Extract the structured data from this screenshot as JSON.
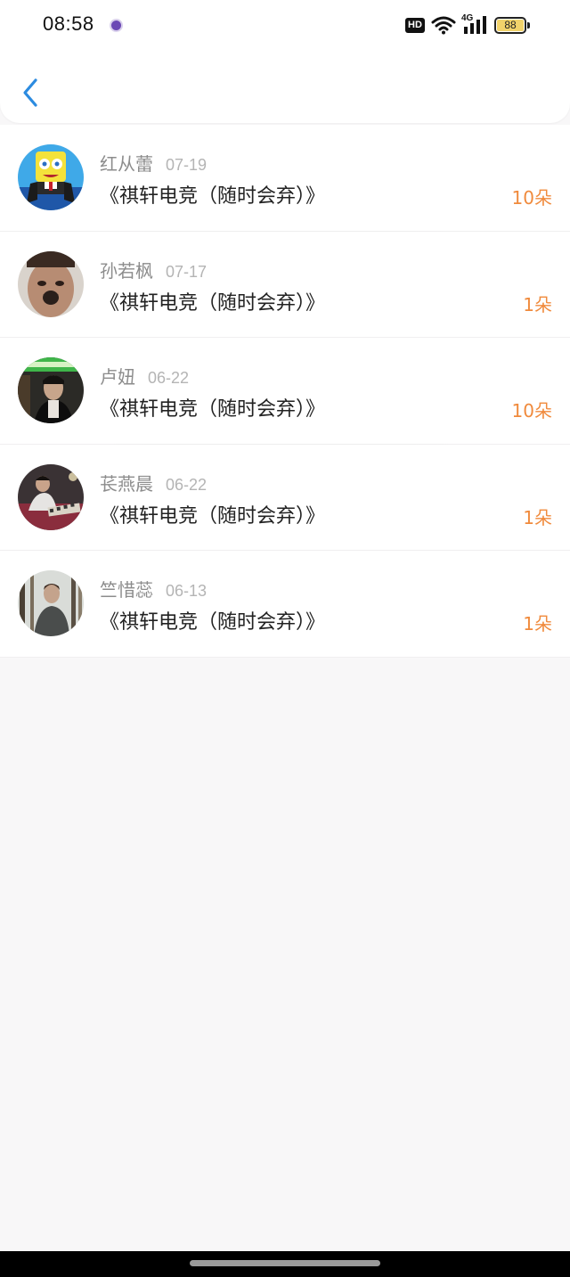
{
  "status_bar": {
    "time": "08:58",
    "hd_label": "HD",
    "network_label": "4G",
    "battery_level": "88",
    "icons": [
      "notification-dot-icon",
      "hd-icon",
      "wifi-icon",
      "signal-icon",
      "battery-icon"
    ]
  },
  "header": {
    "back_icon": "chevron-left-icon",
    "accent_color": "#2c8be0"
  },
  "list": {
    "amount_color": "#f08a3c",
    "items": [
      {
        "name": "红从蕾",
        "date": "07-19",
        "title": "《祺轩电竞（随时会弃）》",
        "amount": "10朵",
        "avatar": "spongebob-avatar"
      },
      {
        "name": "孙若枫",
        "date": "07-17",
        "title": "《祺轩电竞（随时会弃）》",
        "amount": "1朵",
        "avatar": "face-avatar"
      },
      {
        "name": "卢妞",
        "date": "06-22",
        "title": "《祺轩电竞（随时会弃）》",
        "amount": "10朵",
        "avatar": "man-green-banner-avatar"
      },
      {
        "name": "苌燕晨",
        "date": "06-22",
        "title": "《祺轩电竞（随时会弃）》",
        "amount": "1朵",
        "avatar": "man-sitting-avatar"
      },
      {
        "name": "竺惜蕊",
        "date": "06-13",
        "title": "《祺轩电竞（随时会弃）》",
        "amount": "1朵",
        "avatar": "man-forest-avatar"
      }
    ]
  }
}
